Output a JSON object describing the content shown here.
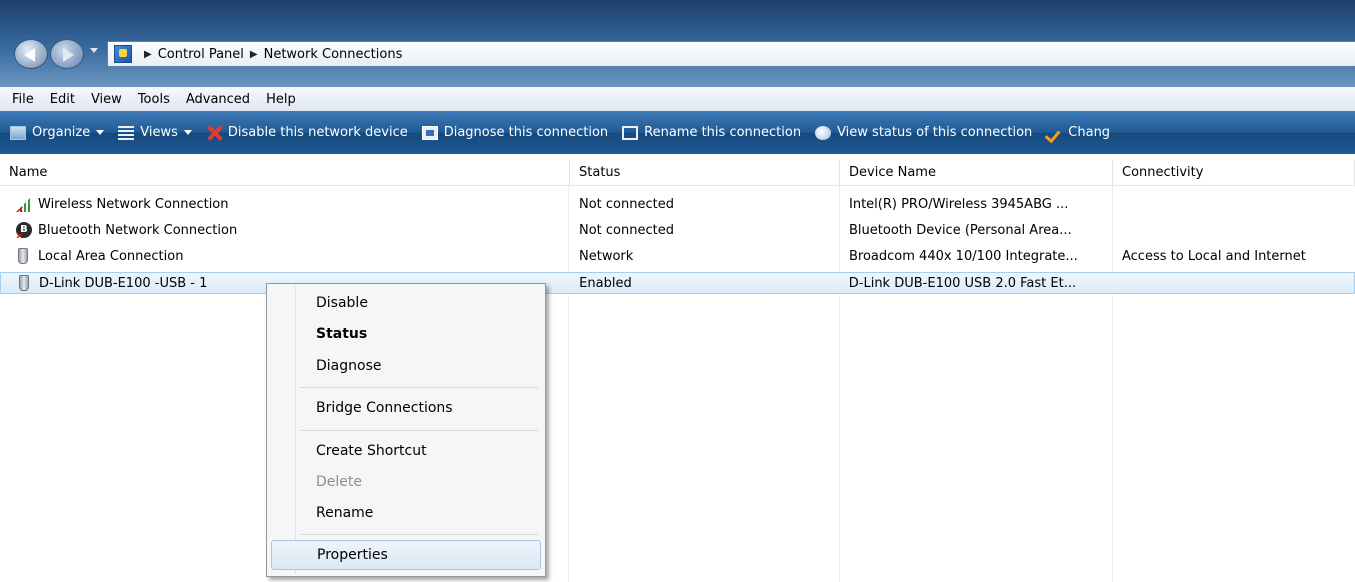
{
  "address": {
    "crumbs": [
      "Control Panel",
      "Network Connections"
    ]
  },
  "menubar": {
    "items": [
      "File",
      "Edit",
      "View",
      "Tools",
      "Advanced",
      "Help"
    ]
  },
  "toolbar": {
    "organize": "Organize",
    "views": "Views",
    "disable": "Disable this network device",
    "diagnose": "Diagnose this connection",
    "rename": "Rename this connection",
    "view_status": "View status of this connection",
    "change": "Chang"
  },
  "columns": [
    "Name",
    "Status",
    "Device Name",
    "Connectivity"
  ],
  "rows": [
    {
      "name": "Wireless Network Connection",
      "status": "Not connected",
      "device": "Intel(R) PRO/Wireless 3945ABG ...",
      "connectivity": "",
      "icon": "wireless-icon"
    },
    {
      "name": "Bluetooth Network Connection",
      "status": "Not connected",
      "device": "Bluetooth Device (Personal Area...",
      "connectivity": "",
      "icon": "bluetooth-icon"
    },
    {
      "name": "Local Area Connection",
      "status": "Network",
      "device": "Broadcom 440x 10/100 Integrate...",
      "connectivity": "Access to Local and Internet",
      "icon": "network-adapter-icon"
    },
    {
      "name": "D-Link DUB-E100 -USB - 1",
      "status": "Enabled",
      "device": "D-Link DUB-E100 USB 2.0 Fast Et...",
      "connectivity": "",
      "icon": "network-adapter-icon"
    }
  ],
  "context_menu": {
    "disable": "Disable",
    "status": "Status",
    "diagnose": "Diagnose",
    "bridge": "Bridge Connections",
    "shortcut": "Create Shortcut",
    "delete": "Delete",
    "rename": "Rename",
    "properties": "Properties"
  },
  "colors": {
    "command_bar": "#1f5a95",
    "selection": "#d9ecfb",
    "disable_icon": "#e23b2e"
  }
}
